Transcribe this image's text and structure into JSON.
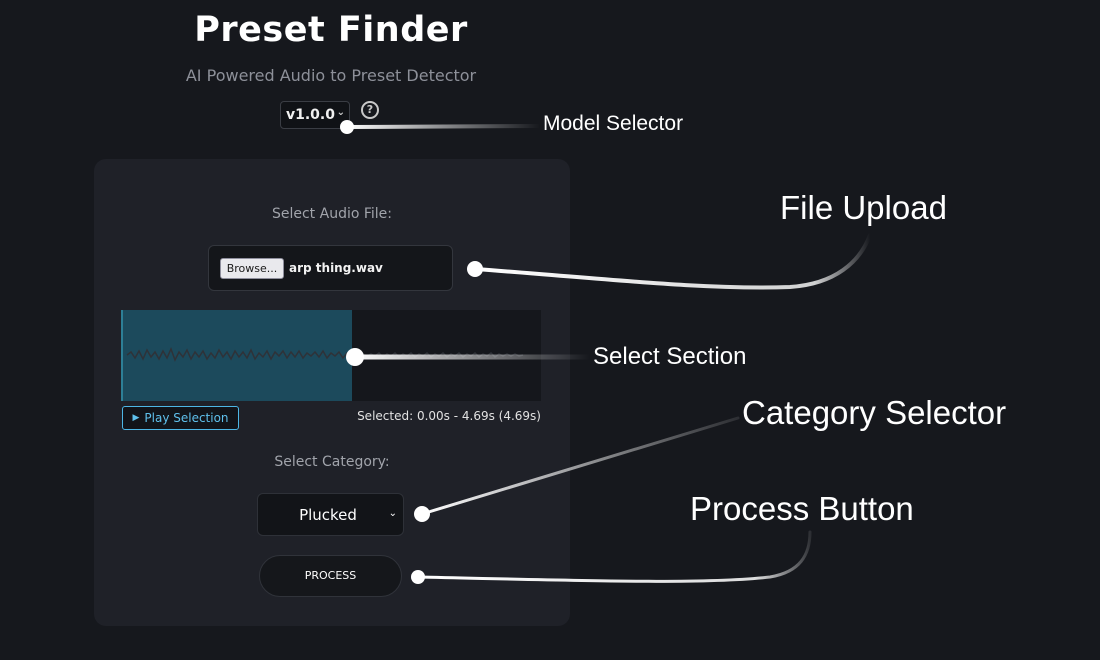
{
  "header": {
    "title": "Preset Finder",
    "subtitle": "AI Powered Audio to Preset Detector",
    "model_version": "v1.0.0",
    "help_symbol": "?"
  },
  "form": {
    "audio_label": "Select Audio File:",
    "browse_label": "Browse...",
    "file_name": "arp thing.wav",
    "play_label": "Play Selection",
    "selection_info": "Selected: 0.00s - 4.69s (4.69s)",
    "selection_fraction": 0.55,
    "category_label": "Select Category:",
    "category_value": "Plucked",
    "process_label": "PROCESS"
  },
  "annotations": {
    "model_selector": "Model Selector",
    "file_upload": "File Upload",
    "select_section": "Select Section",
    "category_selector": "Category Selector",
    "process_button": "Process Button"
  },
  "colors": {
    "background": "#16181d",
    "panel": "#1f2128",
    "selection": "#1c4a5c",
    "accent": "#4db6e5"
  }
}
